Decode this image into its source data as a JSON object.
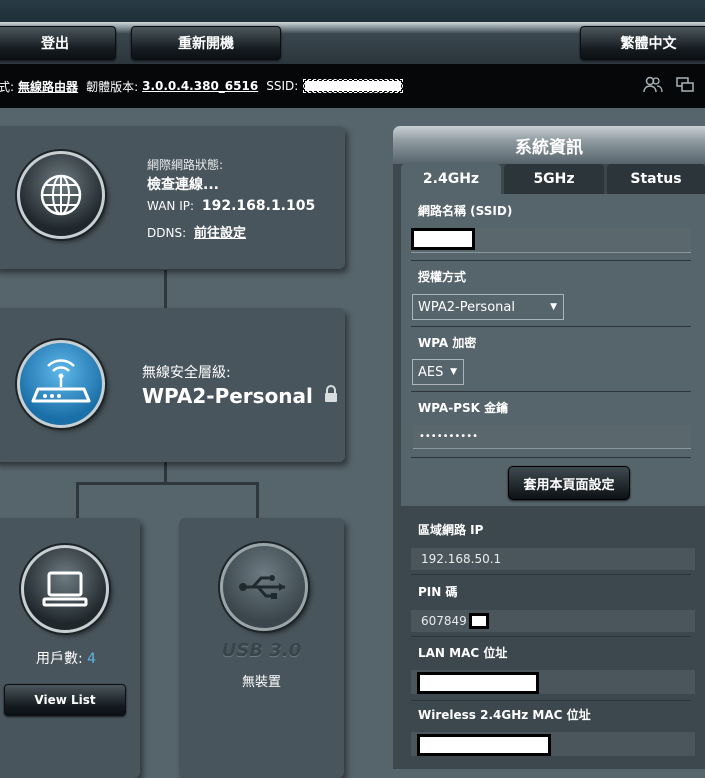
{
  "header": {
    "logout_label": "登出",
    "reboot_label": "重新開機",
    "language_label": "繁體中文"
  },
  "infobar": {
    "mode_prefix": "式:",
    "mode_value": "無線路由器",
    "firmware_label": "韌體版本:",
    "firmware_value": "3.0.0.4.380_6516",
    "ssid_label": "SSID:"
  },
  "map": {
    "internet": {
      "status_label": "網際網路狀態:",
      "status_value": "檢查連線...",
      "wan_label": "WAN IP:",
      "wan_value": "192.168.1.105",
      "ddns_label": "DDNS:",
      "ddns_link": "前往設定"
    },
    "router": {
      "security_label": "無線安全層級:",
      "security_value": "WPA2-Personal"
    },
    "clients": {
      "count_label": "用戶數:",
      "count_value": "4",
      "view_list_label": "View List"
    },
    "usb": {
      "usb_label": "USB 3.0",
      "status": "無裝置"
    }
  },
  "system_info": {
    "title": "系統資訊",
    "tabs": [
      "2.4GHz",
      "5GHz",
      "Status"
    ],
    "ssid_label": "網路名稱 (SSID)",
    "auth_label": "授權方式",
    "auth_value": "WPA2-Personal",
    "wpa_enc_label": "WPA 加密",
    "wpa_enc_value": "AES",
    "psk_label": "WPA-PSK 金鑰",
    "psk_value": "••••••••••",
    "apply_label": "套用本頁面設定",
    "lan_ip_label": "區域網路 IP",
    "lan_ip_value": "192.168.50.1",
    "pin_label": "PIN 碼",
    "pin_value": "607849",
    "lan_mac_label": "LAN MAC 位址",
    "wireless_mac_label": "Wireless 2.4GHz MAC 位址"
  }
}
